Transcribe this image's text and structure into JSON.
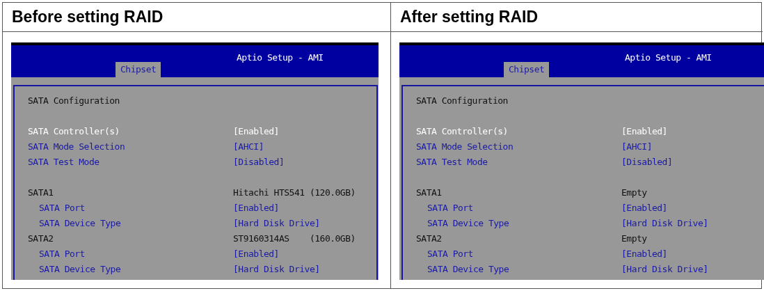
{
  "panels": [
    {
      "heading": "Before setting RAID",
      "screen": {
        "title": "Aptio Setup - AMI",
        "tabs": [
          {
            "label": "Chipset",
            "selected": true
          }
        ],
        "section_title": "SATA Configuration",
        "groups": [
          [
            {
              "kind": "info",
              "label": "SATA Controller(s)",
              "value": "[Enabled]"
            },
            {
              "kind": "option",
              "label": "SATA Mode Selection",
              "value": "[AHCI]"
            },
            {
              "kind": "option",
              "label": "SATA Test Mode",
              "value": "[Disabled]"
            }
          ],
          [
            {
              "kind": "device",
              "label": "SATA1",
              "value": "Hitachi HTS541 (120.0GB)",
              "children": [
                {
                  "kind": "option",
                  "label": "SATA Port",
                  "value": "[Enabled]"
                },
                {
                  "kind": "option",
                  "label": "SATA Device Type",
                  "value": "[Hard Disk Drive]"
                }
              ]
            },
            {
              "kind": "device",
              "label": "SATA2",
              "value": "ST9160314AS    (160.0GB)",
              "children": [
                {
                  "kind": "option",
                  "label": "SATA Port",
                  "value": "[Enabled]"
                },
                {
                  "kind": "option",
                  "label": "SATA Device Type",
                  "value": "[Hard Disk Drive]"
                }
              ]
            }
          ]
        ]
      }
    },
    {
      "heading": "After setting RAID",
      "screen": {
        "title": "Aptio Setup - AMI",
        "tabs": [
          {
            "label": "Chipset",
            "selected": true
          }
        ],
        "section_title": "SATA Configuration",
        "groups": [
          [
            {
              "kind": "info",
              "label": "SATA Controller(s)",
              "value": "[Enabled]"
            },
            {
              "kind": "option",
              "label": "SATA Mode Selection",
              "value": "[AHCI]"
            },
            {
              "kind": "option",
              "label": "SATA Test Mode",
              "value": "[Disabled]"
            }
          ],
          [
            {
              "kind": "device",
              "label": "SATA1",
              "value": "Empty",
              "children": [
                {
                  "kind": "option",
                  "label": "SATA Port",
                  "value": "[Enabled]"
                },
                {
                  "kind": "option",
                  "label": "SATA Device Type",
                  "value": "[Hard Disk Drive]"
                }
              ]
            },
            {
              "kind": "device",
              "label": "SATA2",
              "value": "Empty",
              "children": [
                {
                  "kind": "option",
                  "label": "SATA Port",
                  "value": "[Enabled]"
                },
                {
                  "kind": "option",
                  "label": "SATA Device Type",
                  "value": "[Hard Disk Drive]"
                }
              ]
            }
          ]
        ]
      }
    }
  ]
}
